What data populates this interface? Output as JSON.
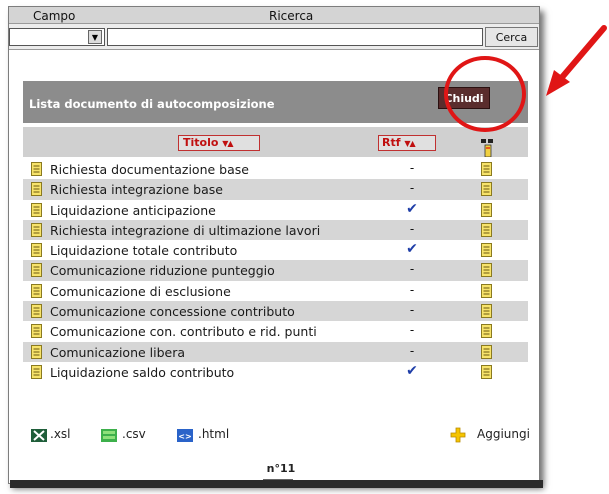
{
  "search": {
    "campo_label": "Campo",
    "ricerca_label": "Ricerca",
    "campo_value": "",
    "ricerca_value": "",
    "cerca_label": "Cerca"
  },
  "panel": {
    "title": "Lista documento di autocomposizione",
    "close_label": "Chiudi"
  },
  "columns": {
    "titolo": "Titolo",
    "rtf": "Rtf"
  },
  "rows": [
    {
      "title": "Richiesta documentazione base",
      "rtf": "-"
    },
    {
      "title": "Richiesta integrazione base",
      "rtf": "-"
    },
    {
      "title": "Liquidazione anticipazione",
      "rtf": "✔"
    },
    {
      "title": "Richiesta integrazione di ultimazione lavori",
      "rtf": "-"
    },
    {
      "title": "Liquidazione totale contributo",
      "rtf": "✔"
    },
    {
      "title": "Comunicazione riduzione punteggio",
      "rtf": "-"
    },
    {
      "title": "Comunicazione di esclusione",
      "rtf": "-"
    },
    {
      "title": "Comunicazione concessione contributo",
      "rtf": "-"
    },
    {
      "title": "Comunicazione con. contributo e rid. punti",
      "rtf": "-"
    },
    {
      "title": "Comunicazione libera",
      "rtf": "-"
    },
    {
      "title": "Liquidazione saldo contributo",
      "rtf": "✔"
    }
  ],
  "export": {
    "xsl": ".xsl",
    "csv": ".csv",
    "html": ".html",
    "add": "Aggiungi"
  },
  "pager": {
    "count": "n°11"
  },
  "icons": {
    "excel": "excel-icon",
    "csv": "csv-icon",
    "html": "html-icon",
    "add": "plus-icon",
    "document": "document-icon",
    "attachment": "attachment-icon",
    "sort": "sort-arrows-icon"
  },
  "colors": {
    "accent_red": "#e01616",
    "header_gray": "#8c8c8c",
    "chiudi_bg": "#5a2d2d",
    "check_blue": "#1f3ea8"
  }
}
